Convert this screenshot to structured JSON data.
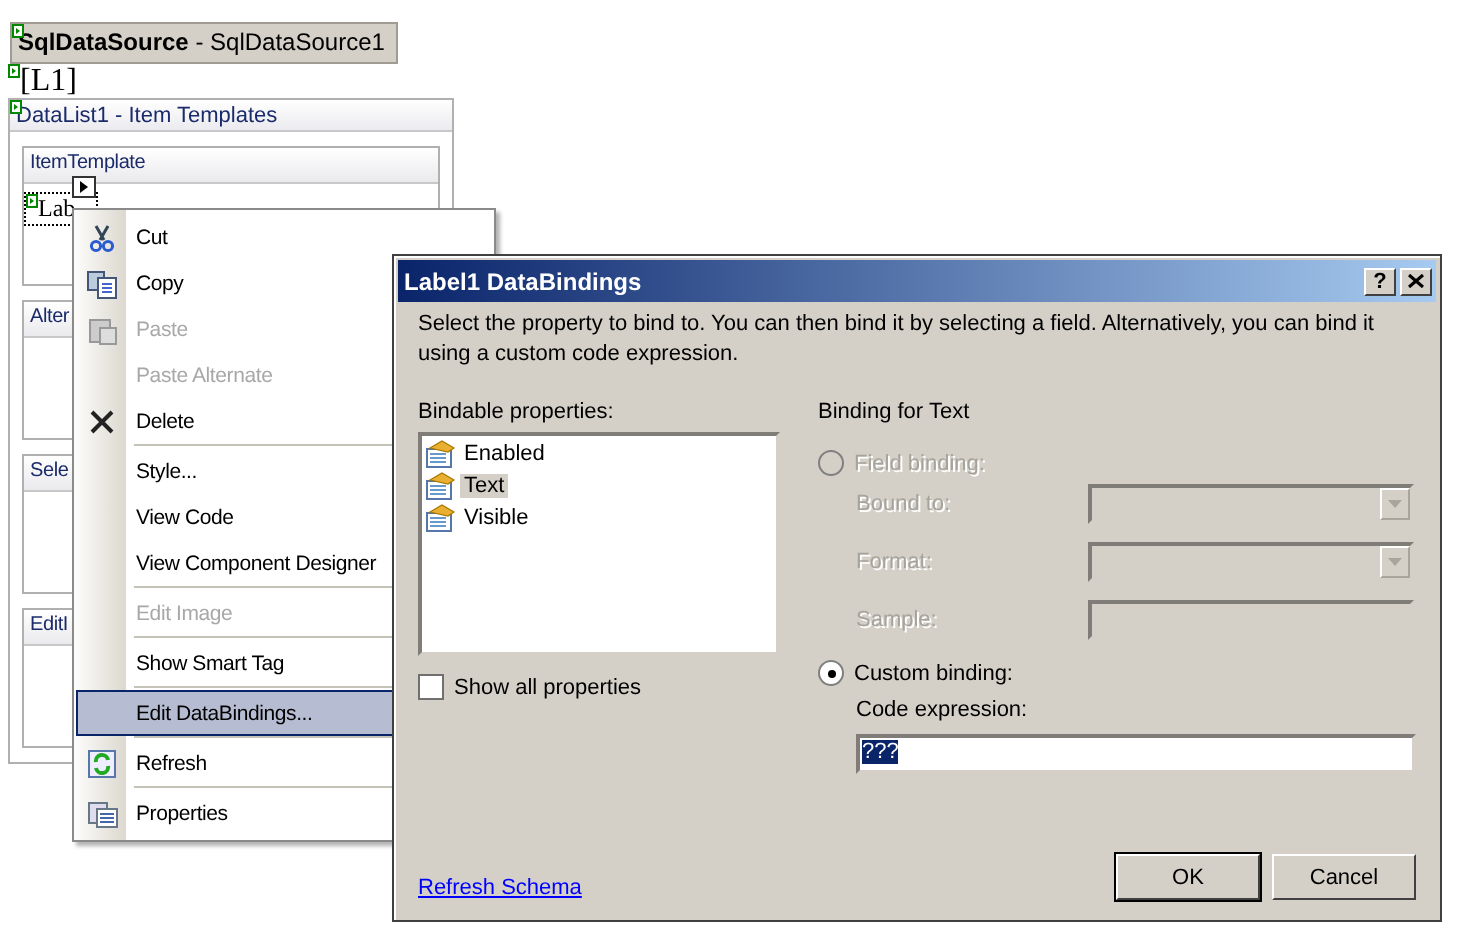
{
  "designer": {
    "data_source": "**SqlDataSource** - SqlDataSource1",
    "label_control": "[L1]",
    "data_list": {
      "title": "DataList1 - Item Templates",
      "templates": [
        {
          "header": "ItemTemplate",
          "label": "Lab"
        },
        {
          "header": "Alter"
        },
        {
          "header": "Sele"
        },
        {
          "header": "EditI"
        }
      ]
    }
  },
  "context_menu": {
    "items": [
      {
        "kind": "command",
        "label": "Cut",
        "disabled": false,
        "selected": false
      },
      {
        "kind": "command",
        "label": "Copy",
        "disabled": false,
        "selected": false
      },
      {
        "kind": "command",
        "label": "Paste",
        "disabled": true,
        "selected": false
      },
      {
        "kind": "command",
        "label": "Paste Alternate",
        "disabled": true,
        "selected": false
      },
      {
        "kind": "command",
        "label": "Delete",
        "disabled": false,
        "selected": false
      },
      {
        "kind": "separator"
      },
      {
        "kind": "command",
        "label": "Style...",
        "disabled": false,
        "selected": false
      },
      {
        "kind": "command",
        "label": "View Code",
        "disabled": false,
        "selected": false
      },
      {
        "kind": "command",
        "label": "View Component Designer",
        "disabled": false,
        "selected": false
      },
      {
        "kind": "separator"
      },
      {
        "kind": "command",
        "label": "Edit Image",
        "disabled": true,
        "selected": false
      },
      {
        "kind": "separator"
      },
      {
        "kind": "command",
        "label": "Show Smart Tag",
        "disabled": false,
        "selected": false
      },
      {
        "kind": "separator"
      },
      {
        "kind": "command",
        "label": "Edit DataBindings...",
        "disabled": false,
        "selected": true
      },
      {
        "kind": "separator"
      },
      {
        "kind": "command",
        "label": "Refresh",
        "disabled": false,
        "selected": false
      },
      {
        "kind": "separator"
      },
      {
        "kind": "command",
        "label": "Properties",
        "disabled": false,
        "selected": false
      }
    ]
  },
  "dialog": {
    "title": "Label1 DataBindings",
    "help_button": "?",
    "description": "Select the property to bind to. You can then bind it by selecting a field. Alternatively, you can bind it using a custom code expression.",
    "bindable_properties": {
      "label": "Bindable properties:",
      "items": [
        {
          "label": "Enabled",
          "selected": false
        },
        {
          "label": "Text",
          "selected": true
        },
        {
          "label": "Visible",
          "selected": false
        }
      ]
    },
    "show_all_properties": {
      "label": "Show all properties",
      "checked": false
    },
    "binding": {
      "title": "Binding for Text",
      "field_binding": {
        "label": "Field binding:",
        "selected": false,
        "disabled": true
      },
      "fields": [
        {
          "kind": "combo",
          "label": "Bound to:"
        },
        {
          "kind": "combo",
          "label": "Format:"
        },
        {
          "kind": "text",
          "label": "Sample:"
        }
      ],
      "custom_binding": {
        "label": "Custom binding:",
        "selected": true
      },
      "code_expression": {
        "label": "Code expression:",
        "value": "???"
      }
    },
    "refresh_link": "Refresh Schema",
    "buttons": [
      "OK",
      "Cancel"
    ]
  }
}
